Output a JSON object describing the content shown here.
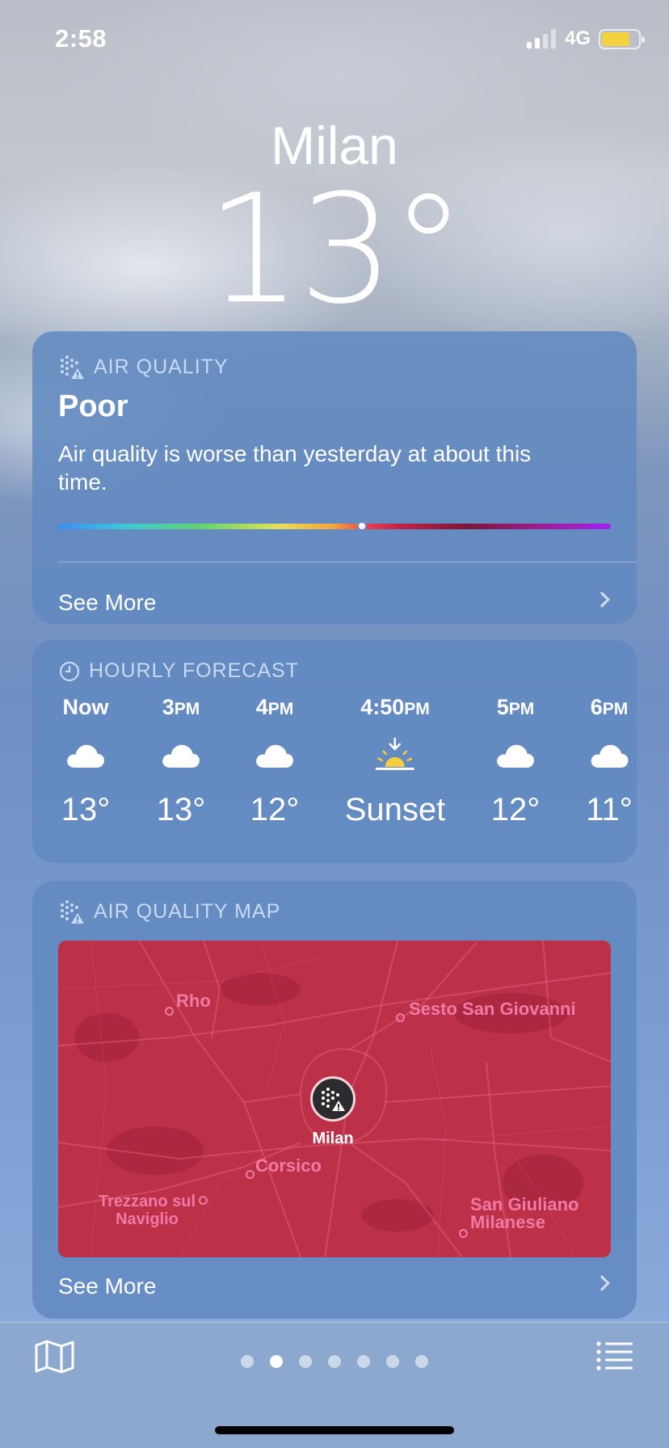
{
  "status_bar": {
    "time": "2:58",
    "network": "4G",
    "battery_color": "#f4d33e"
  },
  "location": {
    "city": "Milan",
    "temperature": "13°"
  },
  "air_quality": {
    "header": "AIR QUALITY",
    "status": "Poor",
    "description": "Air quality is worse than yesterday at about this time.",
    "scale_position": 0.55,
    "see_more": "See More"
  },
  "hourly_forecast": {
    "header": "HOURLY FORECAST",
    "hours": [
      {
        "time": "Now",
        "suffix": "",
        "icon": "cloud-icon",
        "value": "13°"
      },
      {
        "time": "3",
        "suffix": "PM",
        "icon": "cloud-icon",
        "value": "13°"
      },
      {
        "time": "4",
        "suffix": "PM",
        "icon": "cloud-icon",
        "value": "12°"
      },
      {
        "time": "4:50",
        "suffix": "PM",
        "icon": "sunset-icon",
        "value": "Sunset"
      },
      {
        "time": "5",
        "suffix": "PM",
        "icon": "cloud-icon",
        "value": "12°"
      },
      {
        "time": "6",
        "suffix": "PM",
        "icon": "cloud-icon",
        "value": "11°"
      }
    ]
  },
  "air_quality_map": {
    "header": "AIR QUALITY MAP",
    "places": [
      "Rho",
      "Sesto San Giovanni",
      "Corsico",
      "Trezzano sul Naviglio",
      "San Giuliano Milanese"
    ],
    "pin_label": "Milan",
    "see_more": "See More"
  },
  "bottom_bar": {
    "page_count": 7,
    "active_page": 1
  }
}
